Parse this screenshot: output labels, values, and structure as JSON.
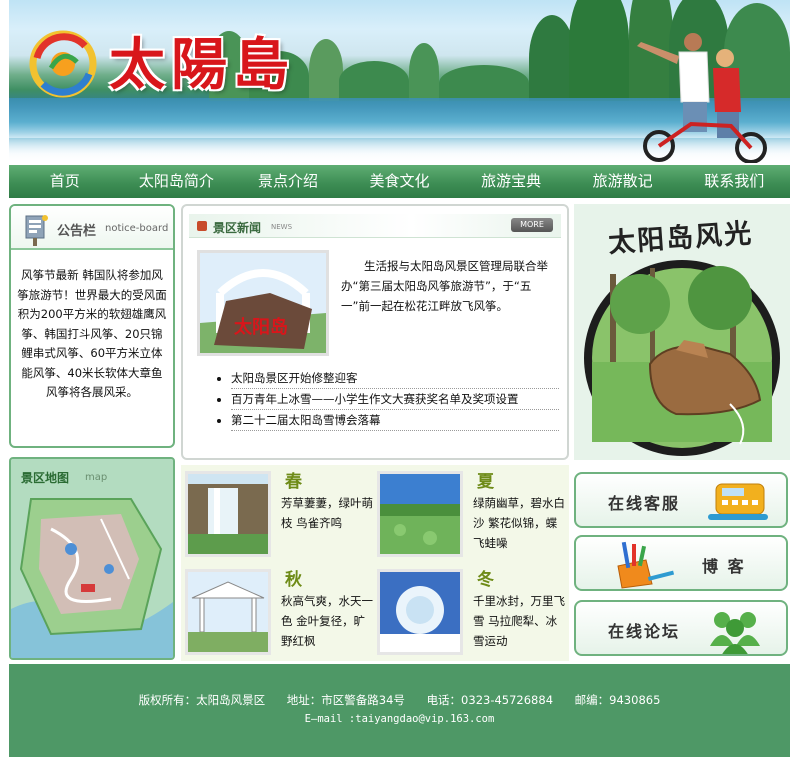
{
  "site": {
    "logo_text": "太陽島"
  },
  "nav": {
    "items": [
      "首页",
      "太阳岛简介",
      "景点介绍",
      "美食文化",
      "旅游宝典",
      "旅游散记",
      "联系我们"
    ]
  },
  "notice": {
    "title": "公告栏",
    "title_en": "notice-board",
    "body": "风筝节最新 韩国队将参加风筝旅游节！世界最大的受风面积为200平方米的软翅雄鹰风筝、韩国打斗风筝、20只锦鲤串式风筝、60平方米立体能风筝、40米长软体大章鱼风筝将各展风采。"
  },
  "map": {
    "title": "景区地图",
    "title_en": "map"
  },
  "news": {
    "title": "景区新闻",
    "title_en": "NEWS",
    "more": "MORE",
    "photo_caption": "太阳岛",
    "lead": "生活报与太阳岛风景区管理局联合举办“第三届太阳岛风筝旅游节”，于“五一”前一起在松花江畔放飞风筝。",
    "items": [
      "太阳岛景区开始修整迎客",
      "百万青年上冰雪——小学生作文大赛获奖名单及奖项设置",
      "第二十二届太阳岛雪博会落幕"
    ]
  },
  "seasons": [
    {
      "name": "春",
      "desc": "芳草萋萋，绿叶萌枝 鸟雀齐鸣"
    },
    {
      "name": "夏",
      "desc": "绿荫幽草，碧水白沙 繁花似锦，蝶飞蛙噪"
    },
    {
      "name": "秋",
      "desc": "秋高气爽，水天一色 金叶复径，旷野红枫"
    },
    {
      "name": "冬",
      "desc": "千里冰封，万里飞雪 马拉爬犁、冰雪运动"
    }
  ],
  "scenery": {
    "title": "太阳岛风光"
  },
  "right_buttons": {
    "service": "在线客服",
    "blog": "博 客",
    "forum": "在线论坛"
  },
  "footer": {
    "copyright": "版权所有：太阳岛风景区",
    "address": "地址：市区警备路34号",
    "phone": "电话：0323-45726884",
    "postcode": "邮编：9430865",
    "email": "E—mail :taiyangdao@vip.163.com"
  },
  "colors": {
    "nav_green": "#3e8e55",
    "footer_green": "#4e9866",
    "logo_red": "#d8161b",
    "season_title": "#6e8b17"
  }
}
